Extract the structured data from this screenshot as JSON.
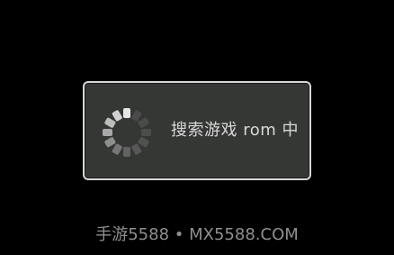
{
  "dialog": {
    "message": "搜索游戏 rom 中",
    "spinner_icon": "loading-spinner-icon"
  },
  "watermark": {
    "text": "手游5588 • MX5588.COM"
  },
  "colors": {
    "background": "#000000",
    "dialog_fill": "#353735",
    "dialog_border": "#d6d6d6",
    "message_text": "#d8d8d8",
    "watermark_text": "#8f8f8f"
  }
}
